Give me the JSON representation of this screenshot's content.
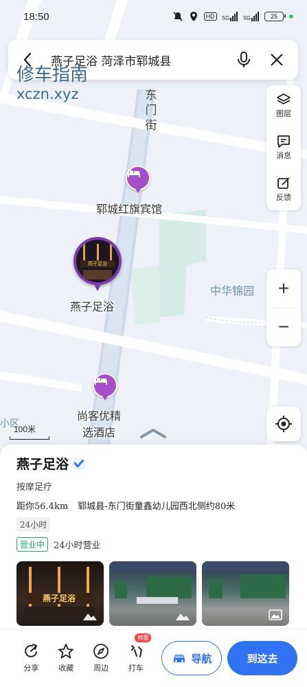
{
  "status_bar": {
    "time": "18:50",
    "network_hd": "HD",
    "signal_1": "5G",
    "signal_2": "5G",
    "battery": "25"
  },
  "search": {
    "query": "燕子足浴 菏泽市郓城县"
  },
  "watermark": {
    "line1": "修车指南",
    "line2": "xczn.xyz"
  },
  "map": {
    "street": [
      "东",
      "门",
      "街"
    ],
    "poi_hotel_1": "郓城红旗宾馆",
    "poi_selected": "燕子足浴",
    "area_label": "中华锦园",
    "poi_hotel_2_line1": "尚客优精",
    "poi_hotel_2_line2": "选酒店",
    "edge_label": "城小区",
    "scale": "100米",
    "pin_sign": "燕子足浴"
  },
  "tools": [
    {
      "icon": "layers-icon",
      "label": "图层"
    },
    {
      "icon": "message-icon",
      "label": "消息"
    },
    {
      "icon": "feedback-icon",
      "label": "反馈"
    }
  ],
  "zoom": {
    "in": "+",
    "out": "−"
  },
  "place": {
    "name": "燕子足浴",
    "category": "按摩足疗",
    "distance": "距你56.4km",
    "address": "郓城县-东门街童鑫幼儿园西北侧约80米",
    "hours_tag": "24小时",
    "open_status": "营业中",
    "open_detail": "24小时营业",
    "photo_sign": "燕子足浴"
  },
  "actions": [
    {
      "icon": "share-icon",
      "label": "分享"
    },
    {
      "icon": "star-icon",
      "label": "收藏"
    },
    {
      "icon": "compass-icon",
      "label": "周边"
    },
    {
      "icon": "taxi-icon",
      "label": "打车",
      "badge": "特惠"
    }
  ],
  "buttons": {
    "navigate": "导航",
    "go_here": "到这去"
  },
  "colors": {
    "accent": "#2f72f2",
    "poi_purple": "#a64ec8",
    "open_green": "#1ea86b"
  }
}
